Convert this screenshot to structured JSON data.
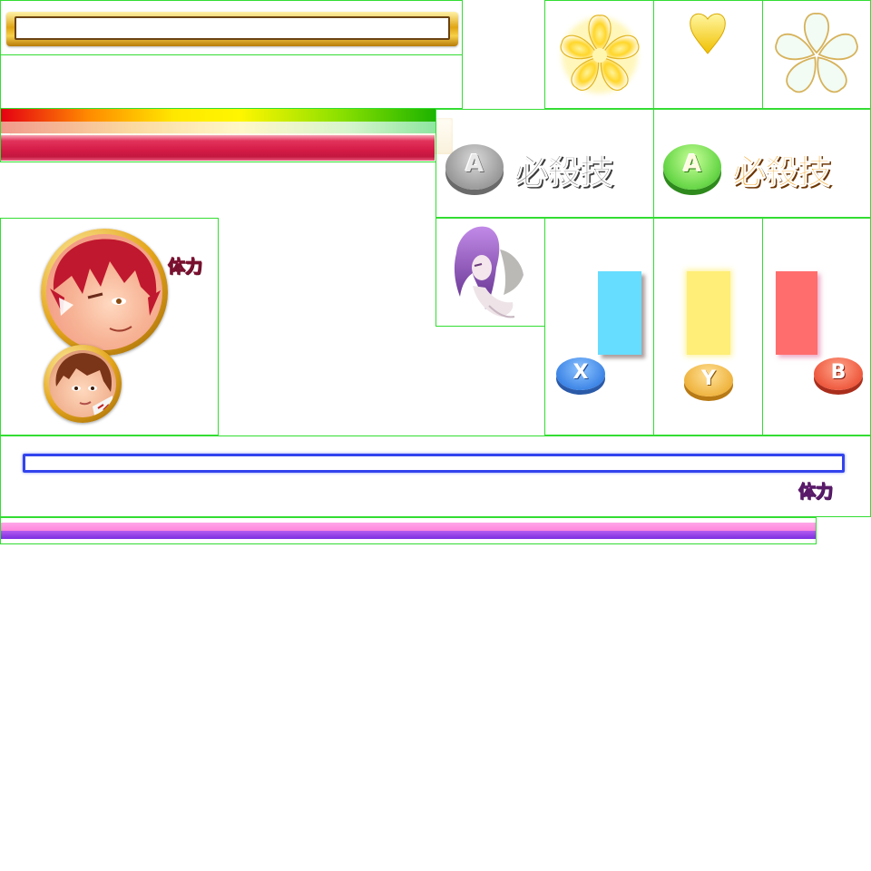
{
  "sprite_sheet": {
    "tiles": [
      {
        "id": "gold-frame-bar"
      },
      {
        "id": "cream-panel"
      },
      {
        "id": "gauge-rainbow"
      },
      {
        "id": "flower-yellow"
      },
      {
        "id": "heart-yellow"
      },
      {
        "id": "flower-white"
      },
      {
        "id": "special-button-inactive"
      },
      {
        "id": "special-button-active"
      },
      {
        "id": "portrait-pair"
      },
      {
        "id": "portrait-purple-hair"
      },
      {
        "id": "button-x-bar"
      },
      {
        "id": "button-y-bar"
      },
      {
        "id": "button-b-bar"
      },
      {
        "id": "hp-frame-blue"
      },
      {
        "id": "hp-bar-pink"
      }
    ]
  },
  "special_move": {
    "button_letter": "A",
    "label": "必殺技"
  },
  "health": {
    "label": "体力"
  },
  "buttons": {
    "x": "X",
    "y": "Y",
    "b": "B"
  },
  "colors": {
    "tile_border": "#33dd33",
    "gold": "#e0a514",
    "crimson": "#d41a46",
    "x_bar": "#66ddff",
    "y_bar": "#ffee77",
    "b_bar": "#ff6d6d",
    "x_button": "#3e86e6",
    "y_button": "#efb440",
    "b_button": "#ee5a3f",
    "hp_frame": "#3344ee",
    "pink": "#ff86dd",
    "purple": "#7b2ee0"
  },
  "icons": [
    "flower-icon",
    "heart-icon",
    "flower-outline-icon",
    "character-portrait",
    "button-x-icon",
    "button-y-icon",
    "button-b-icon",
    "button-a-icon"
  ]
}
